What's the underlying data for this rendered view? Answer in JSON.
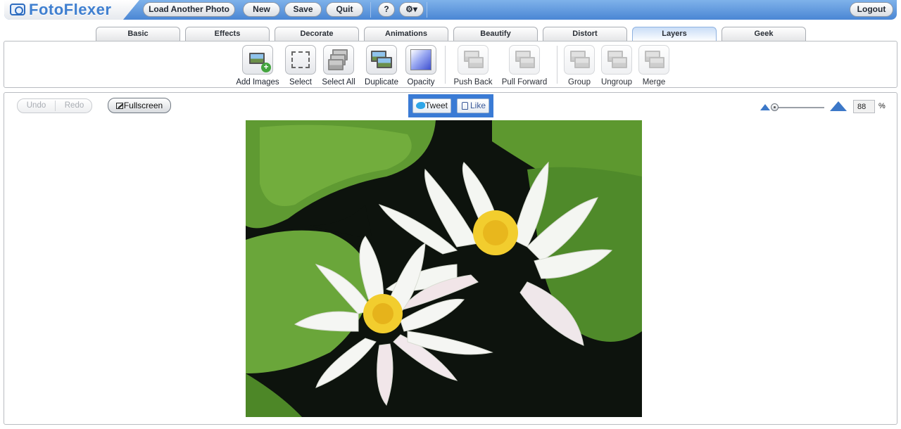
{
  "app": {
    "logo_text": "FotoFlexer"
  },
  "topbar": {
    "load_label": "Load Another Photo",
    "new_label": "New",
    "save_label": "Save",
    "quit_label": "Quit",
    "help_label": "?",
    "settings_label": "⚙▾",
    "logout_label": "Logout"
  },
  "tabs": [
    {
      "label": "Basic"
    },
    {
      "label": "Effects"
    },
    {
      "label": "Decorate"
    },
    {
      "label": "Animations"
    },
    {
      "label": "Beautify"
    },
    {
      "label": "Distort"
    },
    {
      "label": "Layers",
      "active": true
    },
    {
      "label": "Geek"
    }
  ],
  "tools": [
    {
      "label": "Add Images",
      "icon": "add-images-icon"
    },
    {
      "label": "Select",
      "icon": "select-icon"
    },
    {
      "label": "Select All",
      "icon": "select-all-icon"
    },
    {
      "label": "Duplicate",
      "icon": "duplicate-icon"
    },
    {
      "label": "Opacity",
      "icon": "opacity-icon"
    },
    {
      "label": "Push Back",
      "icon": "push-back-icon"
    },
    {
      "label": "Pull Forward",
      "icon": "pull-forward-icon"
    },
    {
      "label": "Group",
      "icon": "group-icon"
    },
    {
      "label": "Ungroup",
      "icon": "ungroup-icon"
    },
    {
      "label": "Merge",
      "icon": "merge-icon"
    }
  ],
  "canvas": {
    "undo_label": "Undo",
    "redo_label": "Redo",
    "fullscreen_label": "Fullscreen",
    "tweet_label": "Tweet",
    "like_label": "Like",
    "zoom_value": "88",
    "zoom_unit": "%"
  },
  "colors": {
    "accent": "#4a86d4",
    "social_bg": "#3a7bd5"
  }
}
